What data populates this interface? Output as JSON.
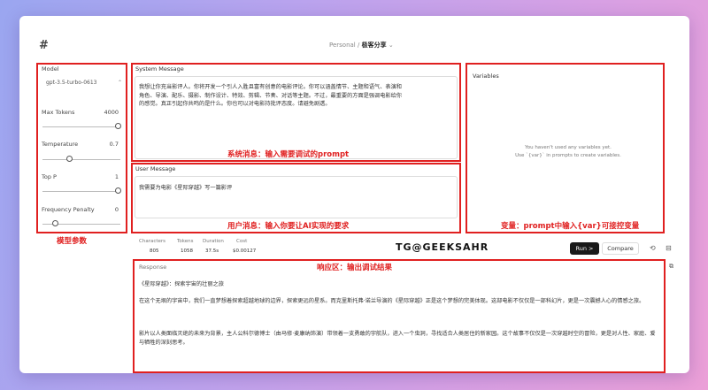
{
  "header": {
    "logo": "#",
    "breadcrumb_prefix": "Personal / ",
    "project": "极客分享",
    "chevron": "⌄"
  },
  "model_panel": {
    "title": "Model",
    "model_select": "gpt-3.5-turbo-0613",
    "params": [
      {
        "label": "Max Tokens",
        "value": "4000",
        "fill": 1.0
      },
      {
        "label": "Temperature",
        "value": "0.7",
        "fill": 0.35
      },
      {
        "label": "Top P",
        "value": "1",
        "fill": 1.0
      },
      {
        "label": "Frequency Penalty",
        "value": "0",
        "fill": 0.0
      }
    ],
    "annotation": "模型参数"
  },
  "system": {
    "title": "System Message",
    "text": "我想让你充当影评人。你将开发一个引人入胜且富有创意的电影评论。你可以涵盖情节、主题和语气、表演和角色、导演、配乐、摄影、制作设计、特效、剪辑、节奏、对话等主题。不过，最重要的方面是强调电影给你的感觉。真正引起你共鸣的是什么。你也可以对电影持批评态度。请避免剧透。",
    "annotation": "系统消息：输入需要调试的prompt"
  },
  "user": {
    "title": "User Message",
    "text": "我需要为电影《星际穿越》写一篇影评",
    "annotation": "用户消息：输入你要让AI实现的要求"
  },
  "variables": {
    "title": "Variables",
    "hint1": "You haven't used any variables yet.",
    "hint2": "Use `{var}` in prompts to create variables.",
    "annotation": "变量：prompt中输入{var}可接控变量"
  },
  "stats": {
    "labels": [
      "Characters",
      "Tokens",
      "Duration",
      "Cost"
    ],
    "values": [
      "805",
      "1058",
      "37.5s",
      "$0.00127"
    ]
  },
  "watermark": "TG@GEEKSAHR",
  "toolbar": {
    "run_label": "Run >",
    "compare_label": "Compare",
    "history_icon": "history-icon",
    "collapse_icon": "collapse-icon"
  },
  "response": {
    "title": "Response",
    "annotation": "响应区：输出调试结果",
    "para1": "《星际穿越》：探索宇宙的壮丽之旅",
    "para2": "在这个无垠的宇宙中，我们一直梦想着探索超越地球的边界，探索更远的星系。而克里斯托弗·诺兰导演的《星际穿越》正是这个梦想的完美体现。这部电影不仅仅是一部科幻片，更是一次震撼人心的情感之旅。",
    "para3": "影片以人类面临灭绝的未来为背景，主人公科尔德博士（由马修·麦康纳饰演）带领着一支勇敢的宇航队，进入一个虫洞，寻找适合人类居住的新家园。这个故事不仅仅是一次穿越时空的冒险，更是对人性、家庭、爱与牺牲的深刻思考。"
  },
  "colors": {
    "annotation_red": "#e02020",
    "run_button": "#1a1a1a"
  }
}
